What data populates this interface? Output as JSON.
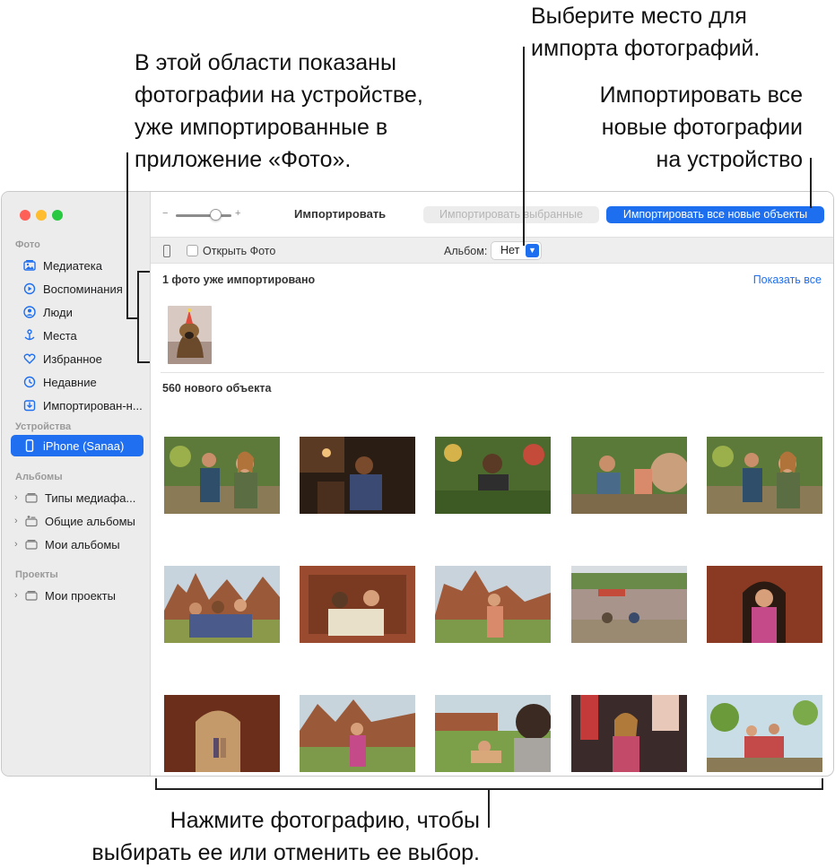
{
  "callouts": {
    "left": [
      "В этой области показаны",
      "фотографии на устройстве,",
      "уже импортированные в",
      "приложение «Фото»."
    ],
    "top_right": [
      "Выберите место для",
      "импорта фотографий."
    ],
    "right": [
      "Импортировать все",
      "новые фотографии",
      "на устройство"
    ],
    "bottom": [
      "Нажмите фотографию, чтобы",
      "выбирать ее или отменить ее выбор."
    ]
  },
  "sidebar": {
    "sections": {
      "photos": "Фото",
      "devices": "Устройства",
      "albums": "Альбомы",
      "projects": "Проекты"
    },
    "items": [
      {
        "label": "Медиатека",
        "icon": "library-icon"
      },
      {
        "label": "Воспоминания",
        "icon": "memories-icon"
      },
      {
        "label": "Люди",
        "icon": "people-icon"
      },
      {
        "label": "Места",
        "icon": "places-icon"
      },
      {
        "label": "Избранное",
        "icon": "heart-icon"
      },
      {
        "label": "Недавние",
        "icon": "clock-icon"
      },
      {
        "label": "Импортирован-н...",
        "icon": "import-icon"
      }
    ],
    "device": "iPhone (Sanaa)",
    "album_groups": [
      "Типы медиафа...",
      "Общие альбомы",
      "Мои альбомы"
    ],
    "project_groups": [
      "Мои проекты"
    ]
  },
  "toolbar": {
    "title": "Импортировать",
    "slider_minus": "−",
    "slider_plus": "+",
    "import_selected": "Импортировать выбранные",
    "import_all": "Импортировать все новые объекты"
  },
  "options": {
    "open_photos": "Открыть Фото",
    "album_label": "Альбом:",
    "album_value": "Нет"
  },
  "content": {
    "imported_heading": "1 фото уже импортировано",
    "show_all": "Показать все",
    "new_heading": "560 нового объекта"
  },
  "colors": {
    "accent": "#1e6ff0",
    "sidebar_bg": "#ececec",
    "close": "#fe5f57",
    "minimize": "#febc2e",
    "maximize": "#28c840"
  }
}
